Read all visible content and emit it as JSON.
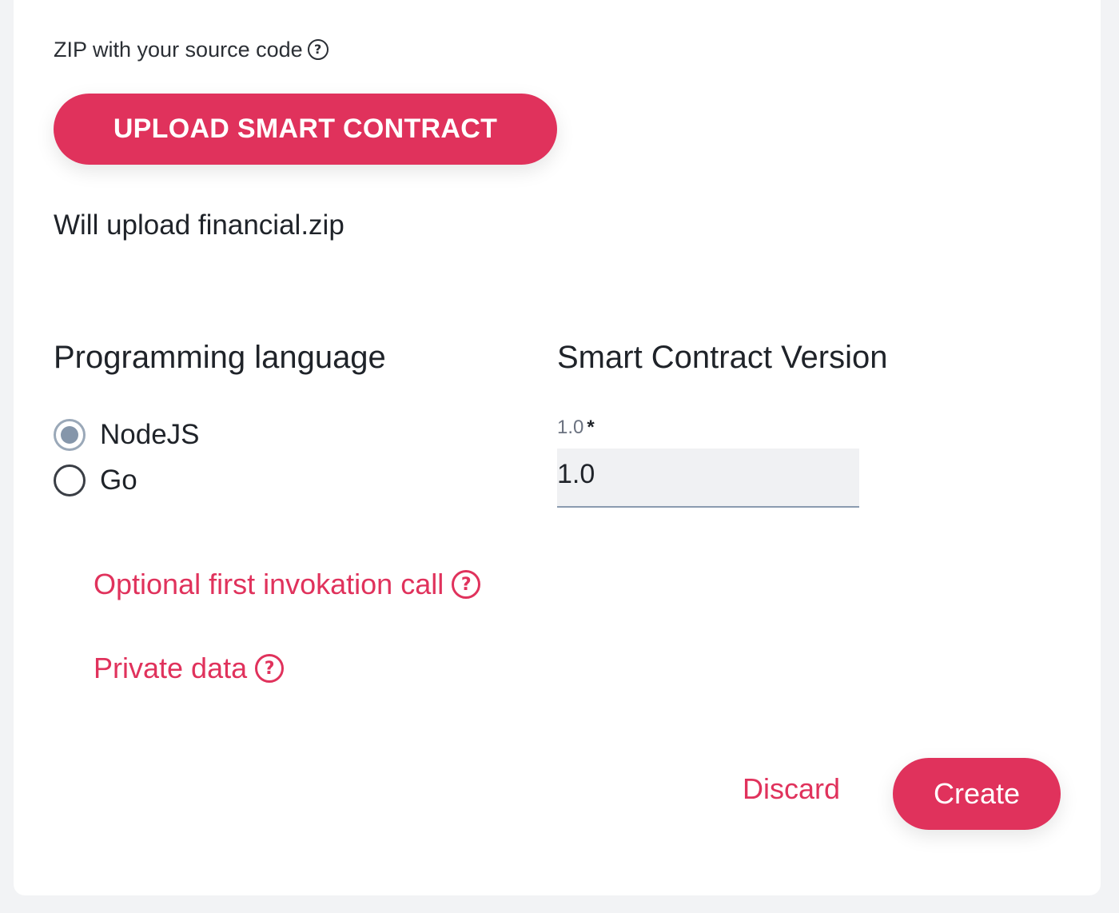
{
  "upload": {
    "zip_label": "ZIP with your source code",
    "button_label": "UPLOAD SMART CONTRACT",
    "status": "Will upload financial.zip"
  },
  "language": {
    "title": "Programming language",
    "options": [
      {
        "label": "NodeJS",
        "selected": true
      },
      {
        "label": "Go",
        "selected": false
      }
    ]
  },
  "version": {
    "title": "Smart Contract Version",
    "field_label": "1.0",
    "required_mark": "*",
    "value": "1.0"
  },
  "links": {
    "invocation": "Optional first invokation call",
    "private_data": "Private data"
  },
  "help_icon_glyph": "?",
  "actions": {
    "discard": "Discard",
    "create": "Create"
  },
  "colors": {
    "accent": "#e0325c",
    "page_bg": "#f2f3f5",
    "card_bg": "#ffffff",
    "radio_selected": "#8596aa"
  },
  "icons": {
    "help": "help-circle-icon"
  }
}
